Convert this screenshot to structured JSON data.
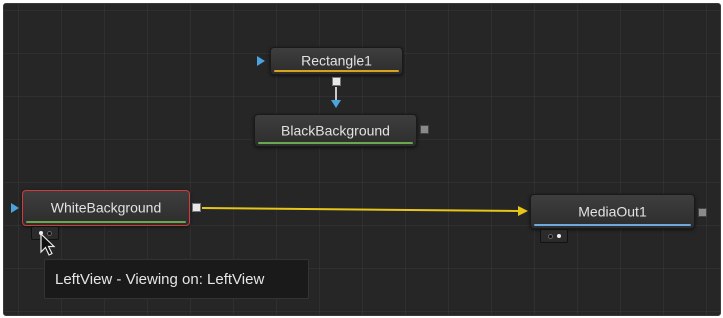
{
  "nodes": {
    "rectangle": {
      "label": "Rectangle1",
      "strip_color": "#d9a21c"
    },
    "black_background": {
      "label": "BlackBackground",
      "strip_color": "#6aa84f"
    },
    "white_background": {
      "label": "WhiteBackground",
      "strip_color": "#6aa84f",
      "selected_color": "#d23b3b"
    },
    "media_out": {
      "label": "MediaOut1",
      "strip_color": "#6fa8dc"
    }
  },
  "connections": [
    {
      "from": "rectangle",
      "to": "black_background",
      "color": "#ffffff",
      "kind": "mask"
    },
    {
      "from": "white_background",
      "to": "media_out",
      "color": "#e6c619",
      "kind": "main"
    }
  ],
  "tooltip": {
    "text": "LeftView - Viewing on: LeftView"
  },
  "colors": {
    "canvas": "#262626",
    "input_port": "#4aa3dc",
    "main_wire": "#e6c619"
  }
}
